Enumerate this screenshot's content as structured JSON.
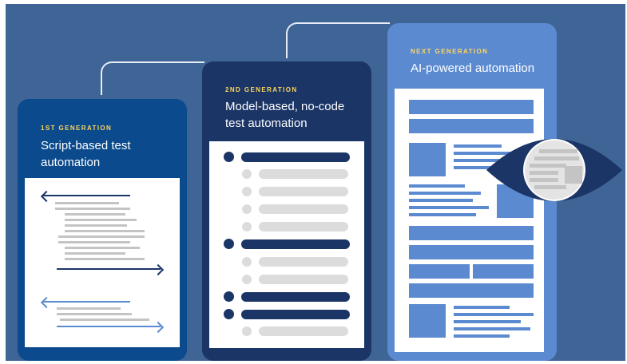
{
  "generations": [
    {
      "tag": "1ST GENERATION",
      "title": "Script-based test automation"
    },
    {
      "tag": "2ND GENERATION",
      "title": "Model-based, no-code test automation"
    },
    {
      "tag": "NEXT GENERATION",
      "title": "AI-powered automation"
    }
  ],
  "colors": {
    "background": "#3f6496",
    "gen1": "#0a4a8d",
    "gen2": "#1a3566",
    "gen3": "#5b8ad1",
    "tag": "#ffd65a",
    "eye": "#1a3566"
  },
  "icons": {
    "gen1_arrows": [
      "arrow-left-icon",
      "arrow-right-icon"
    ],
    "gen3_overlay": "eye-icon"
  }
}
